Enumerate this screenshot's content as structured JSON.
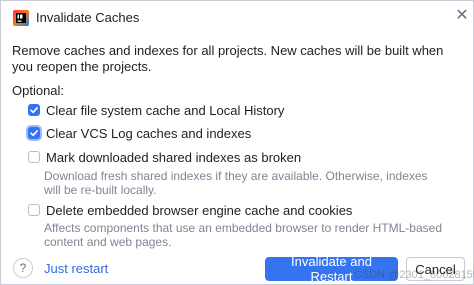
{
  "window": {
    "title": "Invalidate Caches",
    "app_icon": "intellij-app-icon",
    "close_icon": "close-icon"
  },
  "description": "Remove caches and indexes for all projects. New caches will be built when you reopen the projects.",
  "optional_label": "Optional:",
  "options": [
    {
      "label": "Clear file system cache and Local History",
      "checked": true,
      "hint": ""
    },
    {
      "label": "Clear VCS Log caches and indexes",
      "checked": true,
      "hint": ""
    },
    {
      "label": "Mark downloaded shared indexes as broken",
      "checked": false,
      "hint": "Download fresh shared indexes if they are available. Otherwise, indexes will be re-built locally."
    },
    {
      "label": "Delete embedded browser engine cache and cookies",
      "checked": false,
      "hint": "Affects components that use an embedded browser to render HTML-based content and web pages."
    }
  ],
  "footer": {
    "help_label": "?",
    "just_restart": "Just restart",
    "primary_button": "Invalidate and Restart",
    "cancel_button": "Cancel"
  },
  "watermark": "CSDN @2301_80628159",
  "colors": {
    "accent": "#3574f0",
    "link": "#2f6be0",
    "hint_text": "#818594"
  }
}
